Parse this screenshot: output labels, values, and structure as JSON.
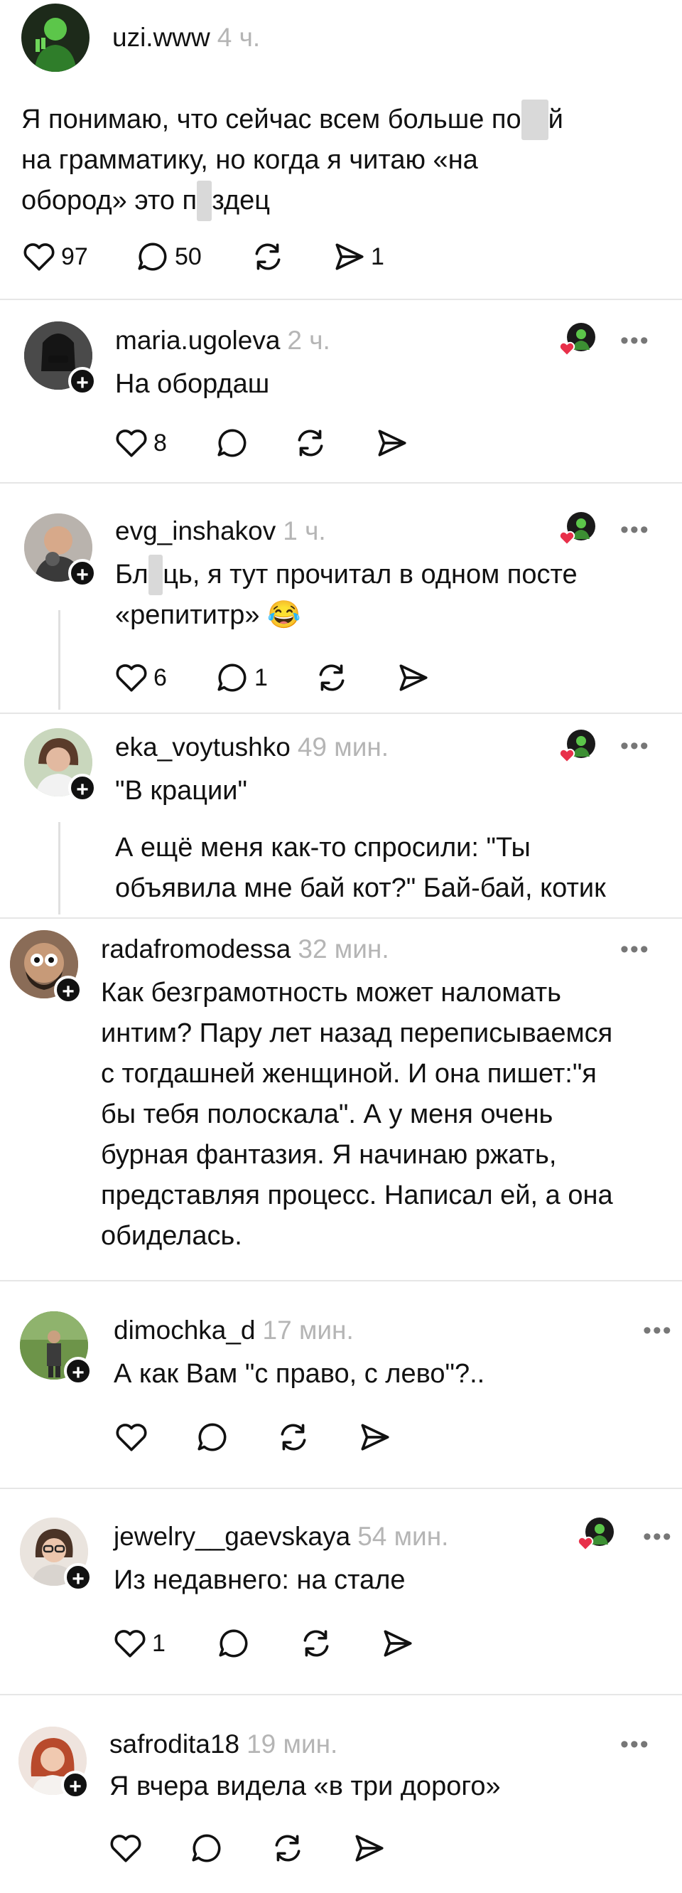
{
  "main_post": {
    "username": "uzi.www",
    "time": "4 ч.",
    "text_l1a": "Я понимаю, что сейчас всем больше по",
    "text_l1b": "й",
    "text_l2": "на грамматику, но когда я читаю «на",
    "text_l3a": "обород» это п",
    "text_l3b": "здец",
    "likes": "97",
    "comments": "50",
    "shares": "1"
  },
  "comments": [
    {
      "username": "maria.ugoleva",
      "time": "2 ч.",
      "text": "На обордаш",
      "likes": "8"
    },
    {
      "username": "evg_inshakov",
      "time": "1 ч.",
      "text_a": "Бл",
      "text_b": "ць, я тут прочитал в одном посте",
      "text_l2": "«репититр» 😂",
      "likes": "6",
      "comments": "1"
    },
    {
      "username": "eka_voytushko",
      "time": "49 мин.",
      "text": "\"В крации\"",
      "reply_l1": "А ещё меня как-то спросили: \"Ты",
      "reply_l2": "объявила мне бай кот?\" Бай-бай, котик"
    },
    {
      "username": "radafromodessa",
      "time": "32 мин.",
      "lines": [
        "Как безграмотность может наломать",
        "интим? Пару лет назад переписываемся",
        "с тогдашней женщиной. И она пишет:\"я",
        "бы тебя полоскала\". А у меня очень",
        "бурная фантазия. Я начинаю ржать,",
        "представляя процесс. Написал ей, а она",
        "обиделась."
      ]
    },
    {
      "username": "dimochka_d",
      "time": "17 мин.",
      "text": "А как Вам \"с право, с лево\"?.."
    },
    {
      "username": "jewelry__gaevskaya",
      "time": "54 мин.",
      "text": "Из недавнего: на стале",
      "likes": "1"
    },
    {
      "username": "safrodita18",
      "time": "19 мин.",
      "text": "Я вчера видела «в три дорого»"
    }
  ],
  "more_label": "•••",
  "plus_label": "+"
}
